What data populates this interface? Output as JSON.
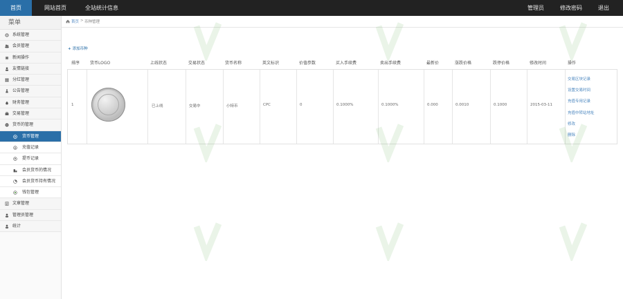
{
  "topnav": {
    "home": "首页",
    "site_home": "网站首页",
    "stats": "全站统计信息",
    "admin": "管理员",
    "change_password": "修改密码",
    "logout": "退出"
  },
  "sidebar": {
    "title": "菜单",
    "items": [
      {
        "label": "系统管理",
        "icon": "gear-icon"
      },
      {
        "label": "会员管理",
        "icon": "users-icon"
      },
      {
        "label": "新闻操作",
        "icon": "settings-icon"
      },
      {
        "label": "友情链接",
        "icon": "user-icon"
      },
      {
        "label": "分红管理",
        "icon": "grid-icon"
      },
      {
        "label": "公告管理",
        "icon": "person-icon"
      },
      {
        "label": "财务管理",
        "icon": "coin-icon"
      },
      {
        "label": "交易管理",
        "icon": "exchange-icon"
      },
      {
        "label": "货币的管理",
        "icon": "minus-circle-icon"
      }
    ],
    "subitems": [
      {
        "label": "货币管理",
        "icon": "coin-small-icon",
        "active": true
      },
      {
        "label": "充值记录",
        "icon": "download-icon"
      },
      {
        "label": "提币记录",
        "icon": "upload-icon"
      },
      {
        "label": "会员货币的情况",
        "icon": "wallet-icon"
      },
      {
        "label": "会员货币持有情况",
        "icon": "chart-icon"
      },
      {
        "label": "钱包管理",
        "icon": "circle-icon"
      }
    ],
    "bottom_items": [
      {
        "label": "文章管理",
        "icon": "doc-icon"
      },
      {
        "label": "管理员管理",
        "icon": "admin-icon"
      },
      {
        "label": "统计",
        "icon": "stats-icon"
      }
    ]
  },
  "breadcrumb": {
    "home": "首页",
    "sep": ">",
    "current": "币种管理"
  },
  "add_button": "添加币种",
  "table": {
    "headers": [
      "排序",
      "货币LOGO",
      "上线状态",
      "交易状态",
      "货币名称",
      "英文标识",
      "价值参数",
      "买入手续费",
      "卖出手续费",
      "最新价",
      "涨跌价格",
      "跌停价格",
      "修改时间",
      "操作"
    ],
    "row": {
      "sort": "1",
      "status": "已上线",
      "trade_status": "交易中",
      "name": "小特币",
      "symbol": "CPC",
      "value": "0",
      "buy_fee": "0.1000%",
      "sell_fee": "0.1000%",
      "latest": "0.000",
      "change": "0.0010",
      "limit_down": "0.1000",
      "updated": "2015-03-11"
    },
    "actions": [
      "交易区块记录",
      "设置交易时间",
      "充值专用记录",
      "充值中转站地址",
      "修改",
      "删除"
    ]
  },
  "colors": {
    "topnav_bg": "#222222",
    "accent": "#2a6fa8",
    "link": "#4a86bf"
  }
}
